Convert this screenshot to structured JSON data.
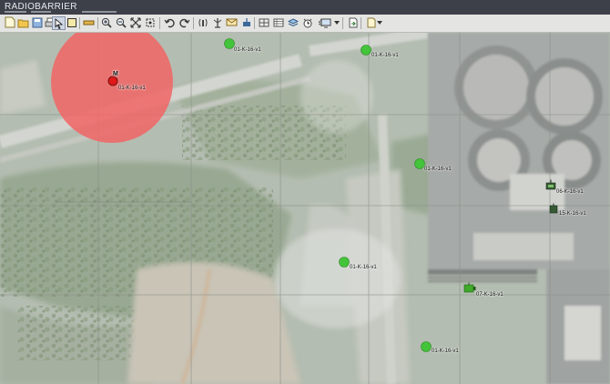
{
  "app": {
    "title": "RADIOBARRIER",
    "menu_items": [
      "",
      "",
      ""
    ]
  },
  "toolbar": {
    "buttons": [
      {
        "icon": "new-document-icon"
      },
      {
        "icon": "open-folder-icon"
      },
      {
        "icon": "save-icon"
      },
      {
        "icon": "print-icon"
      },
      {
        "icon": "select-pointer-icon"
      },
      {
        "icon": "select-rectangle-icon"
      },
      {
        "icon": "ruler-icon"
      },
      {
        "icon": "zoom-in-icon"
      },
      {
        "icon": "zoom-out-icon"
      },
      {
        "icon": "fit-extent-icon"
      },
      {
        "icon": "scale-extent-icon"
      },
      {
        "icon": "undo-icon"
      },
      {
        "icon": "redo-icon"
      },
      {
        "icon": "radio-transmit-icon"
      },
      {
        "icon": "antenna-icon"
      },
      {
        "icon": "message-icon"
      },
      {
        "icon": "jammer-icon"
      },
      {
        "icon": "grid-icon"
      },
      {
        "icon": "table-icon"
      },
      {
        "icon": "layers-icon"
      },
      {
        "icon": "alarm-clock-icon"
      },
      {
        "icon": "settings-icon"
      },
      {
        "icon": "monitor-icon"
      },
      {
        "icon": "export-icon"
      },
      {
        "icon": "document-icon"
      }
    ]
  },
  "colors": {
    "station_green": "#43c43a",
    "danger_zone": "#f06464",
    "target_red": "#e01818",
    "jammer_dark": "#355a35",
    "jammer_green": "#3faa2a"
  },
  "map": {
    "stations": [
      {
        "id": "st1",
        "label": "01-K-16-v1"
      },
      {
        "id": "st2",
        "label": "01-K-16-v1"
      },
      {
        "id": "st3",
        "label": "01-K-16-v1"
      },
      {
        "id": "st4",
        "label": "01-K-16-v1"
      },
      {
        "id": "st5",
        "label": "01-K-16-v1"
      }
    ],
    "target": {
      "label": "01-K-16-v1",
      "marker_text": "M"
    },
    "jammers": [
      {
        "id": "j1",
        "label": "06-K-16-v1"
      },
      {
        "id": "j2",
        "label": "15-K-16-v1"
      },
      {
        "id": "j3",
        "label": "07-K-16-v1"
      }
    ]
  }
}
